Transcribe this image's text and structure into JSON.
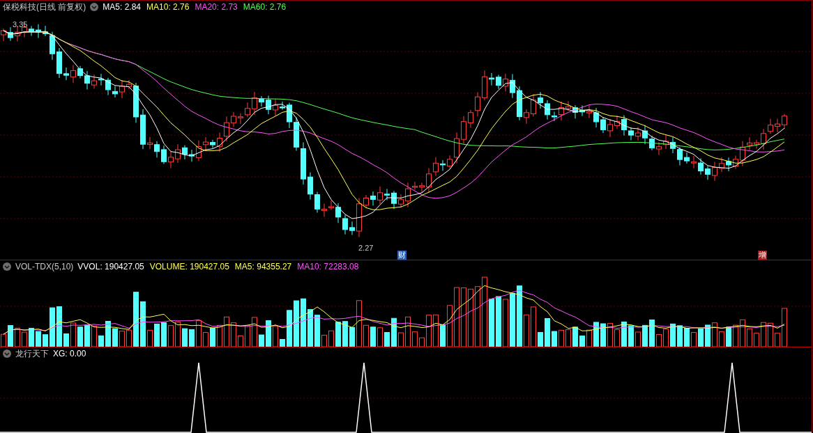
{
  "main_panel": {
    "title": "保税科技(日线 前复权)",
    "indicators": [
      {
        "label": "MA5: 2.84",
        "color": "#ffffff"
      },
      {
        "label": "MA10: 2.76",
        "color": "#ffff54"
      },
      {
        "label": "MA20: 2.73",
        "color": "#ff54ff"
      },
      {
        "label": "MA60: 2.76",
        "color": "#54ff54"
      }
    ],
    "high_label": "3.35",
    "low_label": "2.27",
    "markers": [
      {
        "text": "财",
        "color": "#2f5fb4"
      },
      {
        "text": "增",
        "color": "#a81c1c"
      }
    ]
  },
  "volume_panel": {
    "title": "VOL-TDX(5,10)",
    "indicators": [
      {
        "label": "VVOL: 190427.05",
        "color": "#ffffff"
      },
      {
        "label": "VOLUME: 190427.05",
        "color": "#ffff54"
      },
      {
        "label": "MA5: 94355.27",
        "color": "#ffff54"
      },
      {
        "label": "MA10: 72283.08",
        "color": "#ff54ff"
      }
    ]
  },
  "signal_panel": {
    "title": "龙行天下",
    "indicators": [
      {
        "label": "XG: 0.00",
        "color": "#ffffff"
      }
    ]
  }
}
